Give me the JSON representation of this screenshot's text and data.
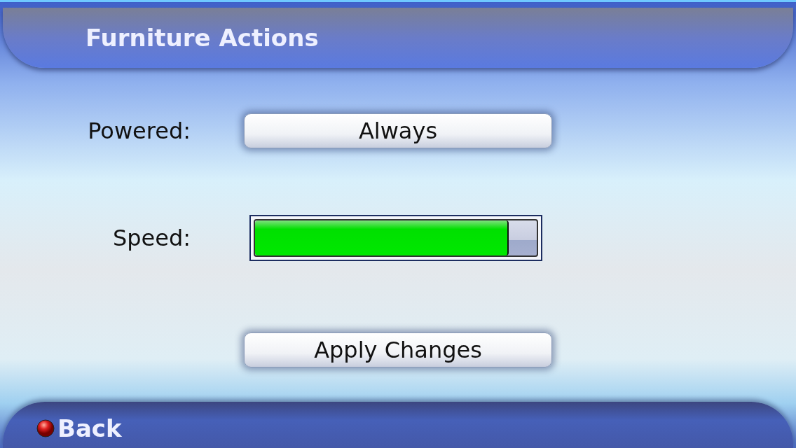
{
  "window": {
    "title": "Furniture Actions"
  },
  "settings": [
    {
      "kind": "choice",
      "label": "Powered:",
      "value": "Always"
    },
    {
      "kind": "slider",
      "label": "Speed:",
      "level": 0.9
    }
  ],
  "apply_button": "Apply Changes",
  "footer": {
    "back": "Back"
  }
}
